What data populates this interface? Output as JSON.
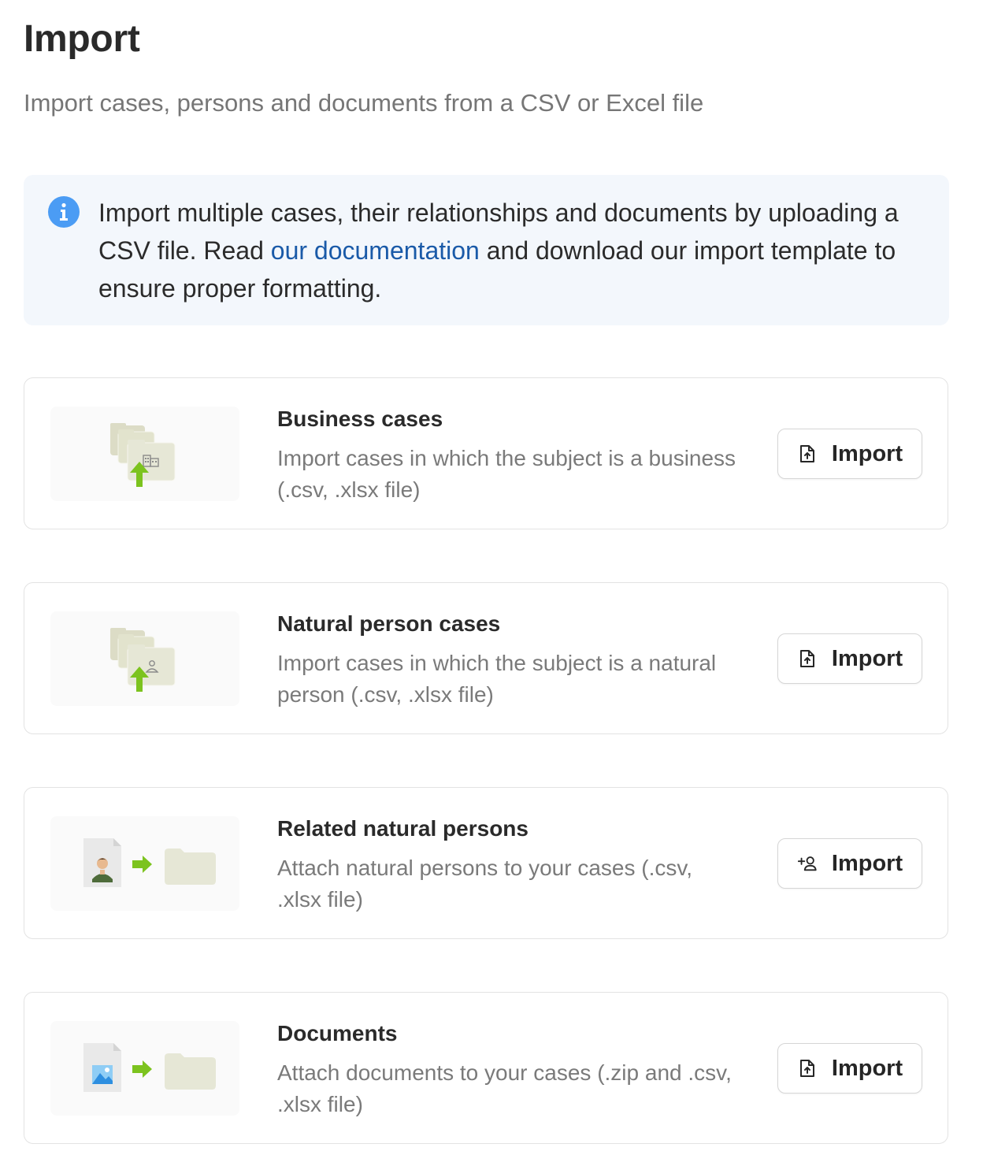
{
  "page": {
    "title": "Import",
    "subtitle": "Import cases, persons and documents from a CSV or Excel file"
  },
  "info": {
    "text_before": "Import multiple cases, their relationships and documents by uploading a CSV file. Read ",
    "link_text": "our documentation",
    "text_after": " and download our import template to ensure proper formatting."
  },
  "cards": [
    {
      "title": "Business cases",
      "description": "Import cases in which the subject is a business (.csv, .xlsx file)",
      "button_label": "Import",
      "button_icon": "file-upload-icon",
      "illustration": "business-folders-upload"
    },
    {
      "title": "Natural person cases",
      "description": "Import cases in which the subject is a natural person (.csv, .xlsx file)",
      "button_label": "Import",
      "button_icon": "file-upload-icon",
      "illustration": "person-folders-upload"
    },
    {
      "title": "Related natural persons",
      "description": "Attach natural persons to your cases (.csv, .xlsx file)",
      "button_label": "Import",
      "button_icon": "add-person-icon",
      "illustration": "person-to-folder"
    },
    {
      "title": "Documents",
      "description": "Attach documents to your cases (.zip and .csv, .xlsx file)",
      "button_label": "Import",
      "button_icon": "file-upload-icon",
      "illustration": "document-to-folder"
    }
  ],
  "colors": {
    "accent_link": "#1a5aa8",
    "info_icon": "#4b9cf4",
    "info_bg": "#f3f7fc",
    "arrow_green": "#7cc31e",
    "folder_tan": "#e6e7d6"
  }
}
